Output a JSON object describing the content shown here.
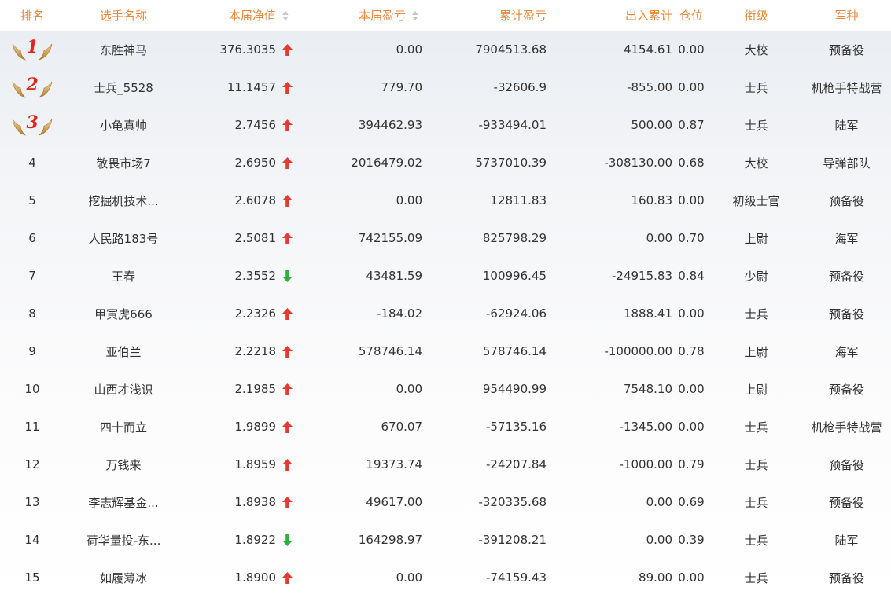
{
  "columns": {
    "rank": "排名",
    "name": "选手名称",
    "nav": "本届净值",
    "pnl": "本届盈亏",
    "cum_pnl": "累计盈亏",
    "flow": "出入累计",
    "position": "仓位",
    "title": "衔级",
    "branch": "军种"
  },
  "colors": {
    "header_text": "#e8863a",
    "up_arrow": "#e53a2f",
    "down_arrow": "#2fb03a",
    "rank_medal_number": "#e0261c"
  },
  "rows": [
    {
      "rank": "1",
      "medal": true,
      "name": "东胜神马",
      "nav": "376.3035",
      "trend": "up",
      "pnl": "0.00",
      "cum_pnl": "7904513.68",
      "flow": "4154.61",
      "position": "0.00",
      "title": "大校",
      "branch": "预备役"
    },
    {
      "rank": "2",
      "medal": true,
      "name": "士兵_5528",
      "nav": "11.1457",
      "trend": "up",
      "pnl": "779.70",
      "cum_pnl": "-32606.9",
      "flow": "-855.00",
      "position": "0.00",
      "title": "士兵",
      "branch": "机枪手特战营"
    },
    {
      "rank": "3",
      "medal": true,
      "name": "小龟真帅",
      "nav": "2.7456",
      "trend": "up",
      "pnl": "394462.93",
      "cum_pnl": "-933494.01",
      "flow": "500.00",
      "position": "0.87",
      "title": "士兵",
      "branch": "陆军"
    },
    {
      "rank": "4",
      "medal": false,
      "name": "敬畏市场7",
      "nav": "2.6950",
      "trend": "up",
      "pnl": "2016479.02",
      "cum_pnl": "5737010.39",
      "flow": "-308130.00",
      "position": "0.68",
      "title": "大校",
      "branch": "导弹部队"
    },
    {
      "rank": "5",
      "medal": false,
      "name": "挖掘机技术...",
      "nav": "2.6078",
      "trend": "up",
      "pnl": "0.00",
      "cum_pnl": "12811.83",
      "flow": "160.83",
      "position": "0.00",
      "title": "初级士官",
      "branch": "预备役"
    },
    {
      "rank": "6",
      "medal": false,
      "name": "人民路183号",
      "nav": "2.5081",
      "trend": "up",
      "pnl": "742155.09",
      "cum_pnl": "825798.29",
      "flow": "0.00",
      "position": "0.70",
      "title": "上尉",
      "branch": "海军"
    },
    {
      "rank": "7",
      "medal": false,
      "name": "王春",
      "nav": "2.3552",
      "trend": "down",
      "pnl": "43481.59",
      "cum_pnl": "100996.45",
      "flow": "-24915.83",
      "position": "0.84",
      "title": "少尉",
      "branch": "预备役"
    },
    {
      "rank": "8",
      "medal": false,
      "name": "甲寅虎666",
      "nav": "2.2326",
      "trend": "up",
      "pnl": "-184.02",
      "cum_pnl": "-62924.06",
      "flow": "1888.41",
      "position": "0.00",
      "title": "士兵",
      "branch": "预备役"
    },
    {
      "rank": "9",
      "medal": false,
      "name": "亚伯兰",
      "nav": "2.2218",
      "trend": "up",
      "pnl": "578746.14",
      "cum_pnl": "578746.14",
      "flow": "-100000.00",
      "position": "0.78",
      "title": "上尉",
      "branch": "海军"
    },
    {
      "rank": "10",
      "medal": false,
      "name": "山西才浅识",
      "nav": "2.1985",
      "trend": "up",
      "pnl": "0.00",
      "cum_pnl": "954490.99",
      "flow": "7548.10",
      "position": "0.00",
      "title": "上尉",
      "branch": "预备役"
    },
    {
      "rank": "11",
      "medal": false,
      "name": "四十而立",
      "nav": "1.9899",
      "trend": "up",
      "pnl": "670.07",
      "cum_pnl": "-57135.16",
      "flow": "-1345.00",
      "position": "0.00",
      "title": "士兵",
      "branch": "机枪手特战营"
    },
    {
      "rank": "12",
      "medal": false,
      "name": "万钱来",
      "nav": "1.8959",
      "trend": "up",
      "pnl": "19373.74",
      "cum_pnl": "-24207.84",
      "flow": "-1000.00",
      "position": "0.79",
      "title": "士兵",
      "branch": "预备役"
    },
    {
      "rank": "13",
      "medal": false,
      "name": "李志辉基金...",
      "nav": "1.8938",
      "trend": "up",
      "pnl": "49617.00",
      "cum_pnl": "-320335.68",
      "flow": "0.00",
      "position": "0.69",
      "title": "士兵",
      "branch": "预备役"
    },
    {
      "rank": "14",
      "medal": false,
      "name": "荷华量投-东...",
      "nav": "1.8922",
      "trend": "down",
      "pnl": "164298.97",
      "cum_pnl": "-391208.21",
      "flow": "0.00",
      "position": "0.39",
      "title": "士兵",
      "branch": "陆军"
    },
    {
      "rank": "15",
      "medal": false,
      "name": "如履薄冰",
      "nav": "1.8900",
      "trend": "up",
      "pnl": "0.00",
      "cum_pnl": "-74159.43",
      "flow": "89.00",
      "position": "0.00",
      "title": "士兵",
      "branch": "预备役"
    }
  ]
}
